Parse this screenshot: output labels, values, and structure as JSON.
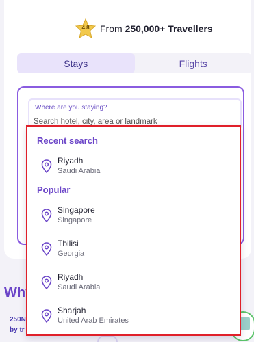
{
  "rating": {
    "score": "4.8",
    "text_prefix": "From",
    "travellers": "250,000+ Travellers"
  },
  "tabs": [
    {
      "label": "Stays",
      "active": true
    },
    {
      "label": "Flights",
      "active": false
    }
  ],
  "search": {
    "label": "Where are you staying?",
    "placeholder": "Search hotel, city, area or landmark",
    "value": ""
  },
  "dropdown": {
    "recent_title": "Recent search",
    "recent": [
      {
        "city": "Riyadh",
        "country": "Saudi Arabia"
      }
    ],
    "popular_title": "Popular",
    "popular": [
      {
        "city": "Singapore",
        "country": "Singapore"
      },
      {
        "city": "Tbilisi",
        "country": "Georgia"
      },
      {
        "city": "Riyadh",
        "country": "Saudi Arabia"
      },
      {
        "city": "Sharjah",
        "country": "United Arab Emirates"
      }
    ]
  },
  "background": {
    "why_heading": "Why",
    "stat_line_1": "250N",
    "stat_line_2": "by tr"
  },
  "colors": {
    "accent": "#6b45c8",
    "highlight_border": "#e0202a",
    "tab_active_bg": "#e9e3fb",
    "star": "#f2c94c"
  },
  "icons": [
    "star-icon",
    "location-pin-icon"
  ]
}
